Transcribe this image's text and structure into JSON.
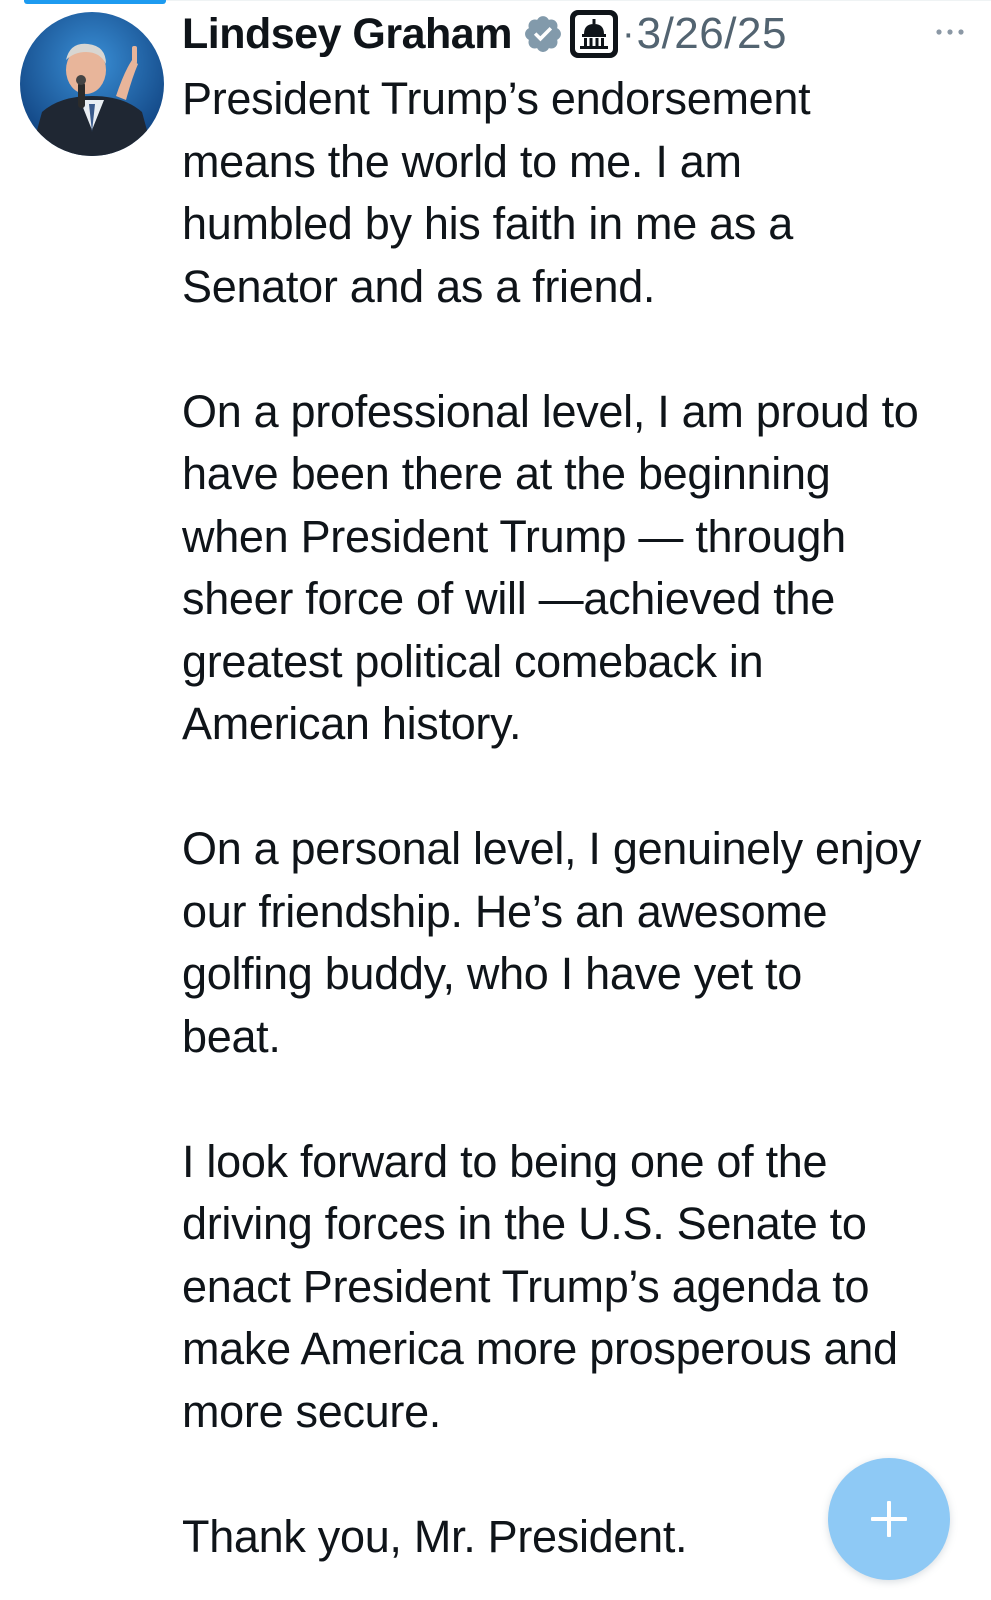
{
  "tweet": {
    "author_name": "Lindsey Graham",
    "separator": "·",
    "timestamp": "3/26/25",
    "paragraphs": [
      "President Trump’s endorsement\nmeans the world to me. I am\nhumbled by his faith in me as a\nSenator and as a friend.",
      "On a professional level, I am proud to\nhave been there at the beginning\nwhen President Trump — through\nsheer force of will —achieved the\ngreatest political comeback in\nAmerican history.",
      "On a personal level, I genuinely enjoy\nour friendship. He’s an awesome\ngolfing buddy, who I have yet to\nbeat.",
      "I look forward to being one of the\ndriving forces in the U.S. Senate to\nenact President Trump’s agenda to\nmake America more prosperous and\nmore secure.",
      "Thank you, Mr. President."
    ]
  },
  "icons": {
    "verified": "verified-badge-icon",
    "affiliate": "capitol-building-icon",
    "more": "more-options-icon",
    "compose": "plus-icon"
  },
  "colors": {
    "accent": "#1d9bf0",
    "verified_badge": "#829aab",
    "fab": "#8ec9f5",
    "secondary_text": "#536471",
    "primary_text": "#0f1419"
  }
}
